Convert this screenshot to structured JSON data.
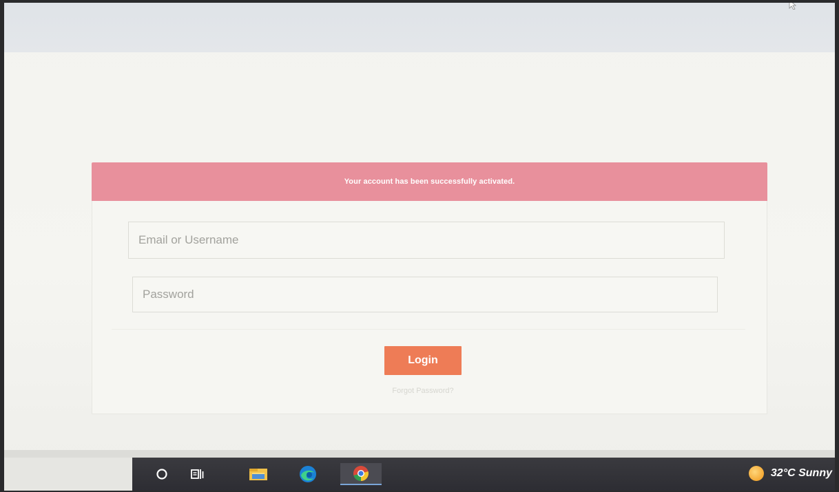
{
  "alert": {
    "message": "Your account has been successfully activated.",
    "color": "#e8909c"
  },
  "login_form": {
    "email_placeholder": "Email or Username",
    "password_placeholder": "Password",
    "login_label": "Login",
    "forgot_label": "Forgot Password?",
    "button_color": "#ee7c56"
  },
  "taskbar": {
    "icons": [
      "cortana-circle-icon",
      "task-view-icon",
      "file-explorer-icon",
      "edge-icon",
      "chrome-icon"
    ],
    "active_icon": "chrome-icon",
    "weather": {
      "icon": "sun-icon",
      "text": "32°C  Sunny"
    }
  }
}
